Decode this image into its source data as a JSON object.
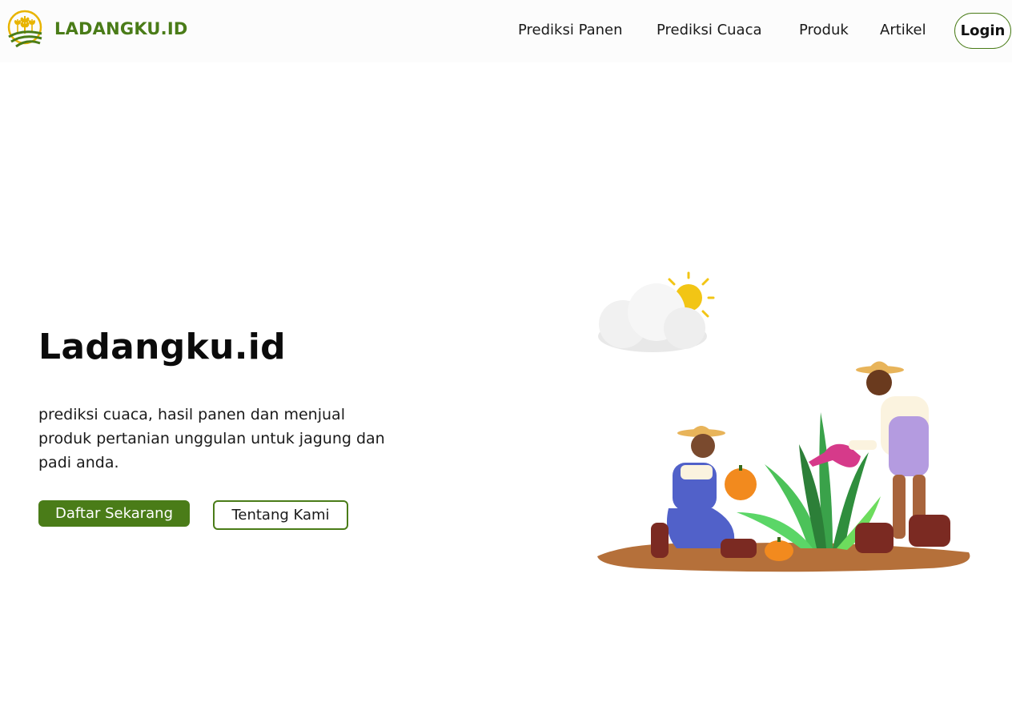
{
  "brand": {
    "name": "LADANGKU.ID",
    "logo_icon": "wheat-field-sun-icon"
  },
  "nav": {
    "items": [
      {
        "label": "Prediksi Panen"
      },
      {
        "label": "Prediksi Cuaca"
      },
      {
        "label": "Produk"
      },
      {
        "label": "Artikel"
      }
    ],
    "login_label": "Login"
  },
  "hero": {
    "title": "Ladangku.id",
    "description": "prediksi cuaca, hasil panen dan menjual produk pertanian unggulan untuk jagung dan padi anda.",
    "primary_button": "Daftar Sekarang",
    "secondary_button": "Tentang Kami",
    "illustration": "farmers-watering-plants-illustration"
  },
  "colors": {
    "brand_green": "#4a7c18",
    "text_dark": "#111111",
    "background": "#ffffff"
  }
}
